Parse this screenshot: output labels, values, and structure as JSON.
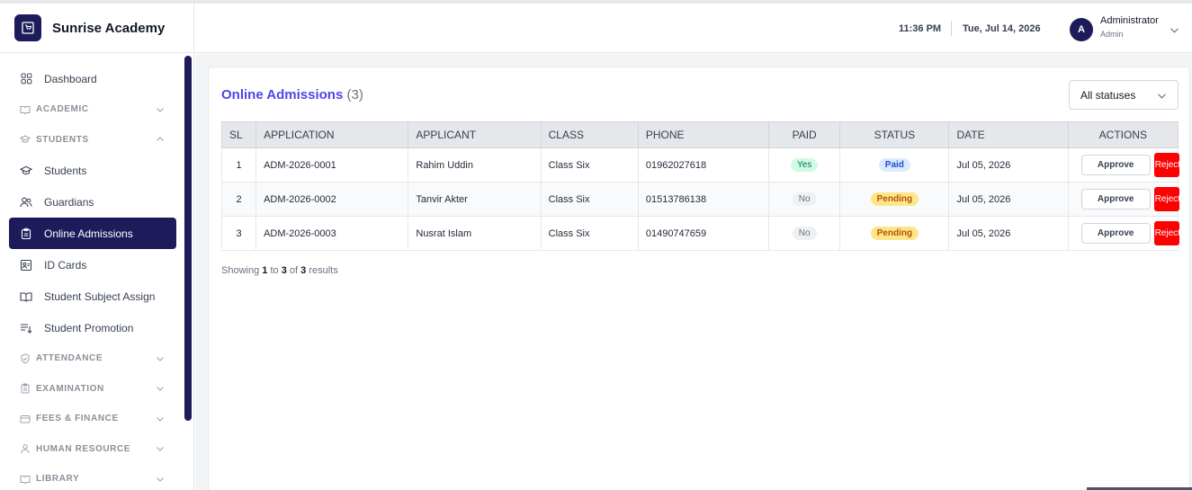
{
  "brand": {
    "name": "Sunrise Academy",
    "logo_icon": "cart-icon",
    "color": "#1e1b5a"
  },
  "header": {
    "time": "11:36 PM",
    "date": "Tue, Jul 14, 2026",
    "user": {
      "initial": "A",
      "name": "Administrator",
      "role": "Admin"
    }
  },
  "sidebar": {
    "dashboard": "Dashboard",
    "academic": "ACADEMIC",
    "students_section": "STUDENTS",
    "items": {
      "students": "Students",
      "guardians": "Guardians",
      "online_admissions": "Online Admissions",
      "id_cards": "ID Cards",
      "subject_assign": "Student Subject Assign",
      "promotion": "Student Promotion"
    },
    "attendance": "ATTENDANCE",
    "examination": "EXAMINATION",
    "fees": "FEES & FINANCE",
    "hr": "HUMAN RESOURCE",
    "library": "LIBRARY"
  },
  "page": {
    "title": "Online Admissions",
    "count": "(3)",
    "status_filter": "All statuses"
  },
  "table": {
    "headers": {
      "sl": "SL",
      "application": "APPLICATION",
      "applicant": "APPLICANT",
      "class": "CLASS",
      "phone": "PHONE",
      "paid": "PAID",
      "status": "STATUS",
      "date": "DATE",
      "actions": "ACTIONS"
    },
    "rows": [
      {
        "sl": "1",
        "application": "ADM-2026-0001",
        "applicant": "Rahim Uddin",
        "class": "Class Six",
        "phone": "01962027618",
        "paid": "Yes",
        "status": "Paid",
        "date": "Jul 05, 2026",
        "approve": "Approve",
        "reject": "Reject"
      },
      {
        "sl": "2",
        "application": "ADM-2026-0002",
        "applicant": "Tanvir Akter",
        "class": "Class Six",
        "phone": "01513786138",
        "paid": "No",
        "status": "Pending",
        "date": "Jul 05, 2026",
        "approve": "Approve",
        "reject": "Reject"
      },
      {
        "sl": "3",
        "application": "ADM-2026-0003",
        "applicant": "Nusrat Islam",
        "class": "Class Six",
        "phone": "01490747659",
        "paid": "No",
        "status": "Pending",
        "date": "Jul 05, 2026",
        "approve": "Approve",
        "reject": "Reject"
      }
    ]
  },
  "footer": {
    "prefix": "Showing",
    "from": "1",
    "to_word": "to",
    "to": "3",
    "of_word": "of",
    "total": "3",
    "suffix": "results"
  }
}
